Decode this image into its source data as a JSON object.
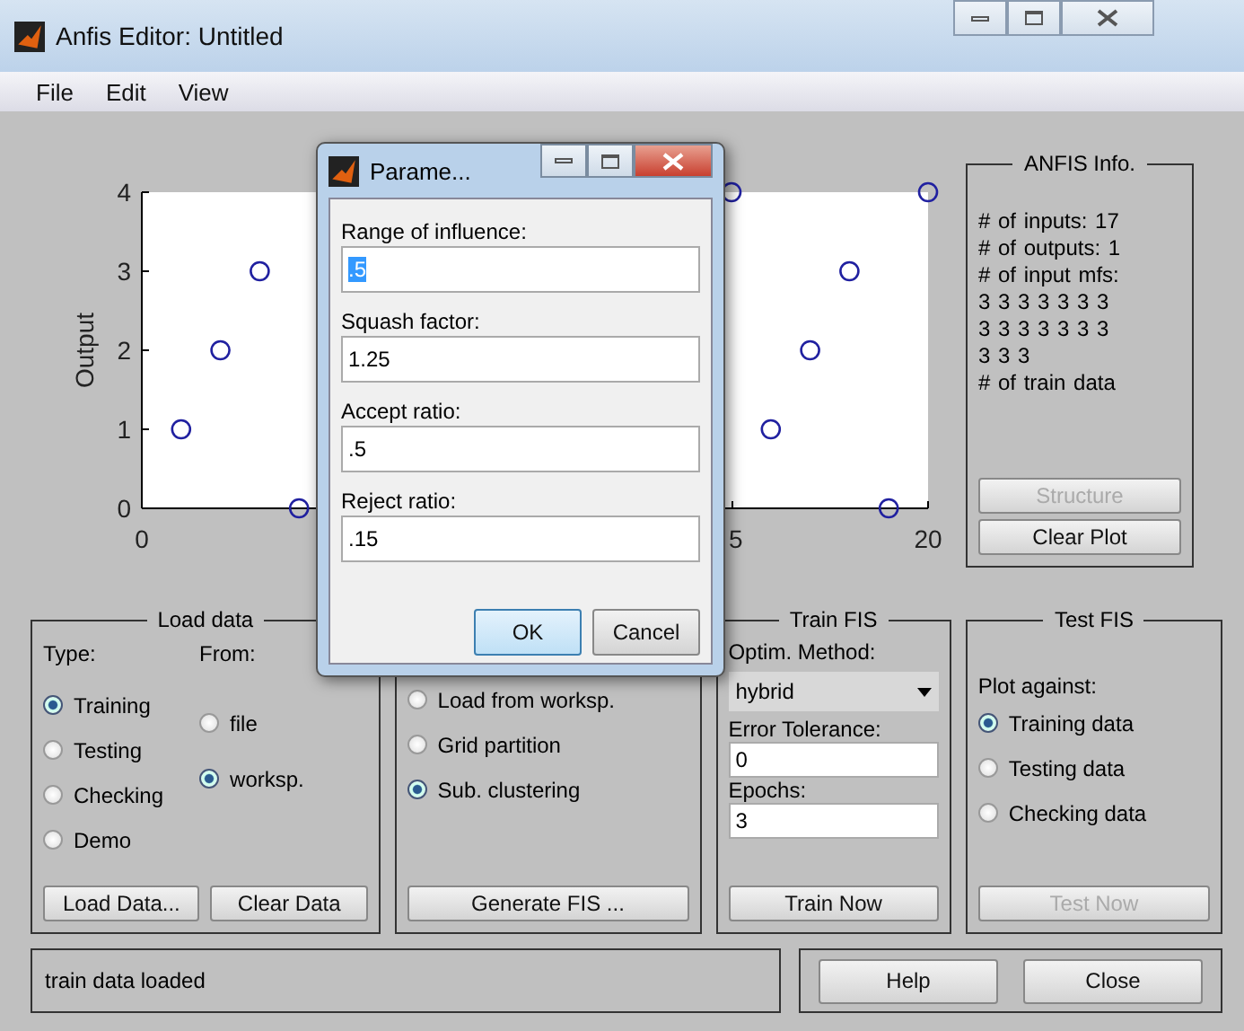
{
  "window": {
    "title": "Anfis Editor: Untitled"
  },
  "menu": [
    "File",
    "Edit",
    "View"
  ],
  "plot": {
    "chart_data": {
      "type": "scatter",
      "ylabel": "Output",
      "x": [
        1,
        2,
        3,
        4,
        15,
        16,
        17,
        18,
        19,
        20
      ],
      "series": [
        {
          "color": "#2020a0",
          "values": [
            1,
            2,
            3,
            0,
            4,
            1,
            2,
            3,
            0,
            4
          ]
        }
      ],
      "xlim": [
        0,
        20
      ],
      "ylim": [
        0,
        4
      ],
      "xticks": [
        0,
        20
      ],
      "yticks": [
        0,
        1,
        2,
        3,
        4
      ]
    },
    "partial_tick_label": "5"
  },
  "anfis_info": {
    "title": "ANFIS Info.",
    "lines": [
      "# of inputs: 17",
      "# of outputs: 1",
      "# of input mfs:",
      "3 3 3 3 3 3 3",
      "3 3 3 3 3 3 3",
      "3 3 3",
      "# of train data"
    ],
    "buttons": [
      {
        "label": "Structure",
        "disabled": true
      },
      {
        "label": "Clear Plot",
        "disabled": false
      }
    ]
  },
  "load_data": {
    "title": "Load data",
    "type_label": "Type:",
    "from_label": "From:",
    "types": [
      {
        "label": "Training",
        "selected": true
      },
      {
        "label": "Testing",
        "selected": false
      },
      {
        "label": "Checking",
        "selected": false
      },
      {
        "label": "Demo",
        "selected": false
      }
    ],
    "sources": [
      {
        "label": "file",
        "selected": false
      },
      {
        "label": "worksp.",
        "selected": true
      }
    ],
    "buttons": [
      "Load Data...",
      "Clear Data"
    ]
  },
  "generate_fis": {
    "options": [
      {
        "label": "Load from worksp.",
        "selected": false
      },
      {
        "label": "Grid partition",
        "selected": false
      },
      {
        "label": "Sub. clustering",
        "selected": true
      }
    ],
    "button": "Generate FIS ..."
  },
  "train_fis": {
    "title": "Train FIS",
    "method_label": "Optim. Method:",
    "method": "hybrid",
    "tolerance_label": "Error Tolerance:",
    "tolerance": "0",
    "epochs_label": "Epochs:",
    "epochs": "3",
    "button": "Train Now"
  },
  "test_fis": {
    "title": "Test FIS",
    "plot_label": "Plot against:",
    "options": [
      {
        "label": "Training data",
        "selected": true
      },
      {
        "label": "Testing data",
        "selected": false
      },
      {
        "label": "Checking data",
        "selected": false
      }
    ],
    "button": {
      "label": "Test Now",
      "disabled": true
    }
  },
  "status": "train data loaded",
  "buttons": [
    "Help",
    "Close"
  ],
  "dialog": {
    "title": "Parame...",
    "fields": [
      {
        "label": "Range of influence:",
        "value": ".5",
        "selected": true
      },
      {
        "label": "Squash factor:",
        "value": "1.25",
        "selected": false
      },
      {
        "label": "Accept ratio:",
        "value": ".5",
        "selected": false
      },
      {
        "label": "Reject ratio:",
        "value": ".15",
        "selected": false
      }
    ],
    "buttons": [
      "OK",
      "Cancel"
    ]
  }
}
